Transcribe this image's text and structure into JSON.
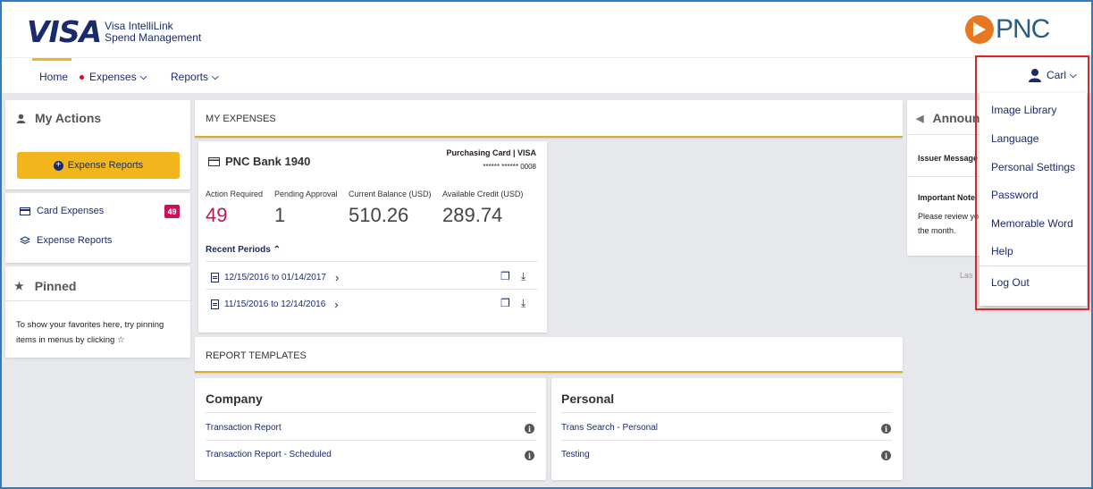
{
  "brand": {
    "visa": "VISA",
    "visa_sub_1": "Visa IntelliLink",
    "visa_sub_2": "Spend Management",
    "pnc": "PNC"
  },
  "nav": {
    "home": "Home",
    "expenses": "Expenses",
    "reports": "Reports",
    "user": "Carl"
  },
  "my_actions": {
    "title": "My Actions",
    "button": "Expense Reports",
    "links": [
      {
        "label": "Card Expenses",
        "badge": "49"
      },
      {
        "label": "Expense Reports"
      }
    ]
  },
  "pinned": {
    "title": "Pinned",
    "text_1": "To show your favorites here, try pinning",
    "text_2": "items in menus by clicking"
  },
  "my_expenses": {
    "title": "MY EXPENSES",
    "card_name": "PNC Bank 1940",
    "card_type": "Purchasing Card | VISA",
    "card_number": "****** ****** 0008",
    "stats": [
      {
        "label": "Action Required",
        "value": "49",
        "color": "#c8105b"
      },
      {
        "label": "Pending Approval",
        "value": "1"
      },
      {
        "label": "Current Balance (USD)",
        "value": "510.26"
      },
      {
        "label": "Available Credit (USD)",
        "value": "289.74"
      }
    ],
    "recent_periods": "Recent Periods",
    "periods": [
      "12/15/2016 to 01/14/2017",
      "11/15/2016 to 12/14/2016"
    ]
  },
  "report_templates": {
    "title": "REPORT TEMPLATES",
    "company": {
      "title": "Company",
      "items": [
        "Transaction Report",
        "Transaction Report - Scheduled"
      ]
    },
    "personal": {
      "title": "Personal",
      "items": [
        "Trans Search - Personal",
        "Testing"
      ]
    }
  },
  "announcements": {
    "title": "Announ",
    "issuer": "Issuer Message",
    "important": "Important Note",
    "text_1": "Please review yo",
    "text_2": "the month.",
    "last": "Las"
  },
  "user_dropdown": {
    "items": [
      "Image Library",
      "Language",
      "Personal Settings",
      "Password",
      "Memorable Word",
      "Help"
    ],
    "logout": "Log Out"
  },
  "colors": {
    "accent": "#f2b61c",
    "navy": "#1a2b6d",
    "badge": "#c8105b",
    "highlight": "#d9262e"
  }
}
